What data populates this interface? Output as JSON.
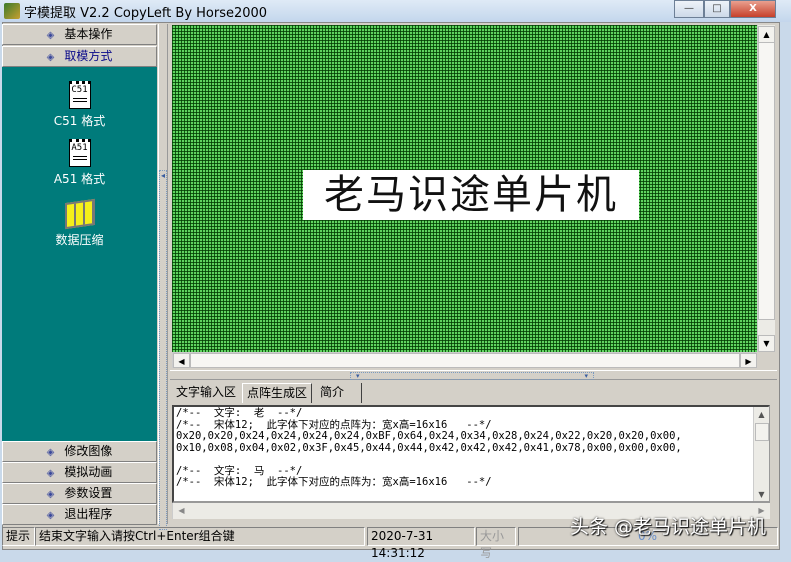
{
  "window": {
    "title": "字模提取 V2.2  CopyLeft By Horse2000",
    "minimize": "—",
    "maximize": "□",
    "close": "X"
  },
  "sidebar": {
    "top_items": [
      {
        "label": "基本操作"
      },
      {
        "label": "取模方式"
      }
    ],
    "tools": [
      {
        "label": "C51 格式",
        "icon_text": "C51"
      },
      {
        "label": "A51 格式",
        "icon_text": "A51"
      },
      {
        "label": "数据压缩"
      }
    ],
    "bottom_items": [
      {
        "label": "修改图像"
      },
      {
        "label": "模拟动画"
      },
      {
        "label": "参数设置"
      },
      {
        "label": "退出程序"
      }
    ]
  },
  "canvas": {
    "text": "老马识途单片机"
  },
  "tabs": [
    {
      "label": "文字输入区"
    },
    {
      "label": "点阵生成区"
    },
    {
      "label": "简介"
    }
  ],
  "output": {
    "lines": [
      "/*--  文字:  老  --*/",
      "/*--  宋体12;  此字体下对应的点阵为：宽x高=16x16   --*/",
      "0x20,0x20,0x24,0x24,0x24,0x24,0xBF,0x64,0x24,0x34,0x28,0x24,0x22,0x20,0x20,0x00,",
      "0x10,0x08,0x04,0x02,0x3F,0x45,0x44,0x44,0x42,0x42,0x42,0x41,0x78,0x00,0x00,0x00,",
      "",
      "/*--  文字:  马  --*/",
      "/*--  宋体12;  此字体下对应的点阵为：宽x高=16x16   --*/"
    ]
  },
  "status": {
    "label": "提示",
    "message": "结束文字输入请按Ctrl+Enter组合键",
    "datetime": "2020-7-31 14:31:12",
    "caps": "大小写",
    "progress": "0%"
  },
  "watermark": "头条 @老马识途单片机"
}
